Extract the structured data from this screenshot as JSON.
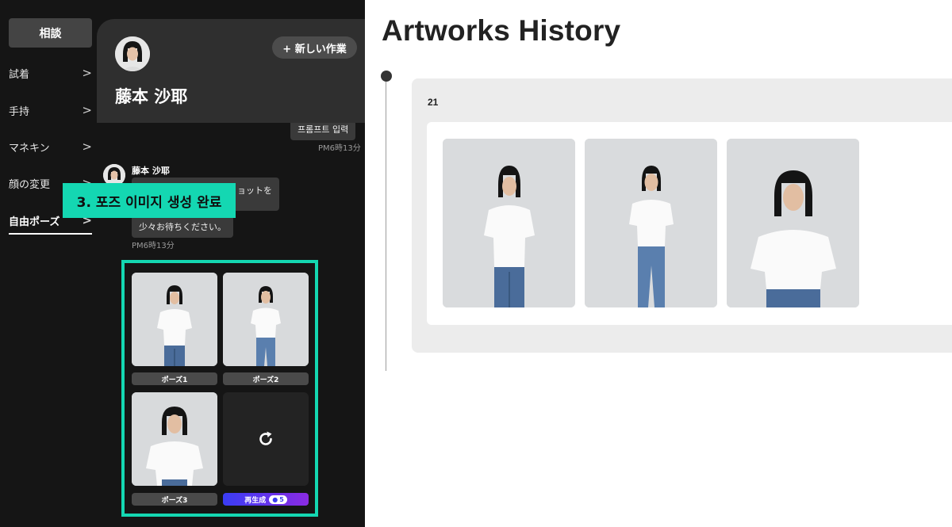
{
  "nav": {
    "consult_label": "相談",
    "items": [
      {
        "label": "試着",
        "chevron": ">"
      },
      {
        "label": "手持",
        "chevron": ">"
      },
      {
        "label": "マネキン",
        "chevron": ">"
      },
      {
        "label": "顔の変更",
        "chevron": ">"
      },
      {
        "label": "自由ポーズ",
        "chevron": ">",
        "active": true
      }
    ]
  },
  "profile": {
    "name": "藤本 沙耶",
    "new_work_label": "+ 新しい作業"
  },
  "chat": {
    "prompt_bubble": "프롬프트 입력",
    "prompt_time": "PM6時13分",
    "sender": "藤本 沙耶",
    "message_partial": "ョットを",
    "wait_message": "少々お待ちください。",
    "message_time": "PM6時13分"
  },
  "overlay": {
    "label": "3. 포즈 이미지 생성 완료"
  },
  "poses": {
    "items": [
      {
        "label": "ポーズ1"
      },
      {
        "label": "ポーズ2"
      },
      {
        "label": "ポーズ3"
      }
    ],
    "regenerate_label": "再生成",
    "regenerate_credits": "5",
    "icons": {
      "regenerate": "refresh-icon",
      "credit": "coin-icon"
    }
  },
  "history": {
    "title": "Artworks History",
    "entry_number": "21",
    "thumb_count_shown": 3
  },
  "colors": {
    "accent_teal": "#14d7b2",
    "regen_gradient_start": "#3a3df5",
    "regen_gradient_end": "#8a2be2",
    "app_bg": "#151515"
  }
}
